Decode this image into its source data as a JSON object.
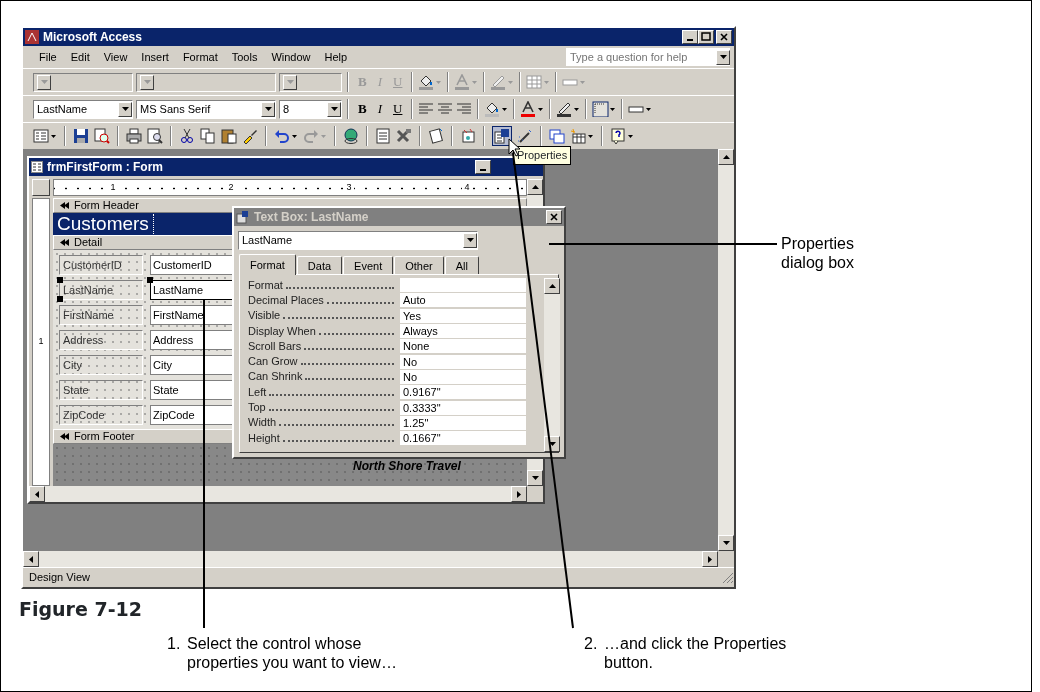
{
  "app": {
    "title": "Microsoft Access",
    "menu": [
      "File",
      "Edit",
      "View",
      "Insert",
      "Format",
      "Tools",
      "Window",
      "Help"
    ],
    "help_placeholder": "Type a question for help"
  },
  "toolbars": [
    {
      "disabled": true,
      "buttons": [
        "B",
        "I",
        "U"
      ]
    },
    {
      "disabled": false,
      "fields": [
        "LastName",
        "MS Sans Serif",
        "8"
      ],
      "buttons": [
        "B",
        "I",
        "U"
      ]
    }
  ],
  "design_toolbar": {
    "properties_pressed": true
  },
  "tooltip": "Properties",
  "form_window": {
    "title": "frmFirstForm : Form",
    "ruler": [
      "1",
      "2",
      "3",
      "4"
    ],
    "side_ruler": "1",
    "header": {
      "label": "Form Header",
      "title": "Customers"
    },
    "detail": {
      "label": "Detail",
      "fields": [
        {
          "label": "CustomerID",
          "control": "CustomerID",
          "selected": false
        },
        {
          "label": "LastName",
          "control": "LastName",
          "selected": true
        },
        {
          "label": "FirstName",
          "control": "FirstName",
          "selected": false
        },
        {
          "label": "Address",
          "control": "Address",
          "selected": false
        },
        {
          "label": "City",
          "control": "City",
          "selected": false
        },
        {
          "label": "State",
          "control": "State",
          "selected": false
        },
        {
          "label": "ZipCode",
          "control": "ZipCode",
          "selected": false
        }
      ]
    },
    "footer": {
      "label": "Form Footer",
      "text": "North Shore Travel"
    }
  },
  "properties_dialog": {
    "title": "Text Box: LastName",
    "object": "LastName",
    "tabs": [
      {
        "label": "Format",
        "selected": true
      },
      {
        "label": "Data",
        "selected": false
      },
      {
        "label": "Event",
        "selected": false
      },
      {
        "label": "Other",
        "selected": false
      },
      {
        "label": "All",
        "selected": false
      }
    ],
    "rows": [
      {
        "name": "Format"
      },
      {
        "name": "Decimal Places",
        "value": "Auto"
      },
      {
        "name": "Visible",
        "value": "Yes"
      },
      {
        "name": "Display When",
        "value": "Always"
      },
      {
        "name": "Scroll Bars",
        "value": "None"
      },
      {
        "name": "Can Grow",
        "value": "No"
      },
      {
        "name": "Can Shrink",
        "value": "No"
      },
      {
        "name": "Left",
        "value": "0.9167\""
      },
      {
        "name": "Top",
        "value": "0.3333\""
      },
      {
        "name": "Width",
        "value": "1.25\""
      },
      {
        "name": "Height",
        "value": "0.1667\""
      }
    ]
  },
  "status_bar": "Design View",
  "figure_caption": "Figure 7-12",
  "dialog_callout": "Properties dialog box",
  "callouts": [
    {
      "number": "1.",
      "text": "Select the control whose properties you want to view…"
    },
    {
      "number": "2.",
      "text": "…and click the Properties button."
    }
  ]
}
